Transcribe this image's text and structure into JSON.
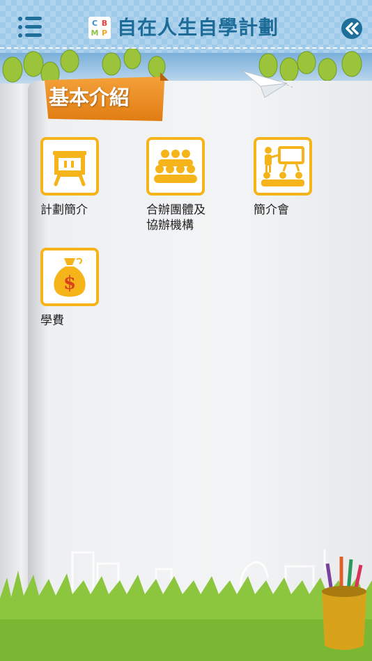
{
  "header": {
    "title": "自在人生自學計劃",
    "logo_text": [
      "C",
      "B",
      "M",
      "P"
    ],
    "accent_color": "#1e6f99",
    "menu_icon": "list-menu-icon",
    "back_icon": "double-chevron-left-icon"
  },
  "section": {
    "title": "基本介紹",
    "ribbon_color": "#ec8c1c"
  },
  "items": [
    {
      "label": "計劃簡介",
      "icon": "presentation-board-icon"
    },
    {
      "label": "合辦團體及\n協辦機構",
      "icon": "group-people-icon"
    },
    {
      "label": "簡介會",
      "icon": "briefing-session-icon"
    },
    {
      "label": "學費",
      "icon": "money-bag-icon"
    }
  ],
  "tile_color": "#f6b41b"
}
